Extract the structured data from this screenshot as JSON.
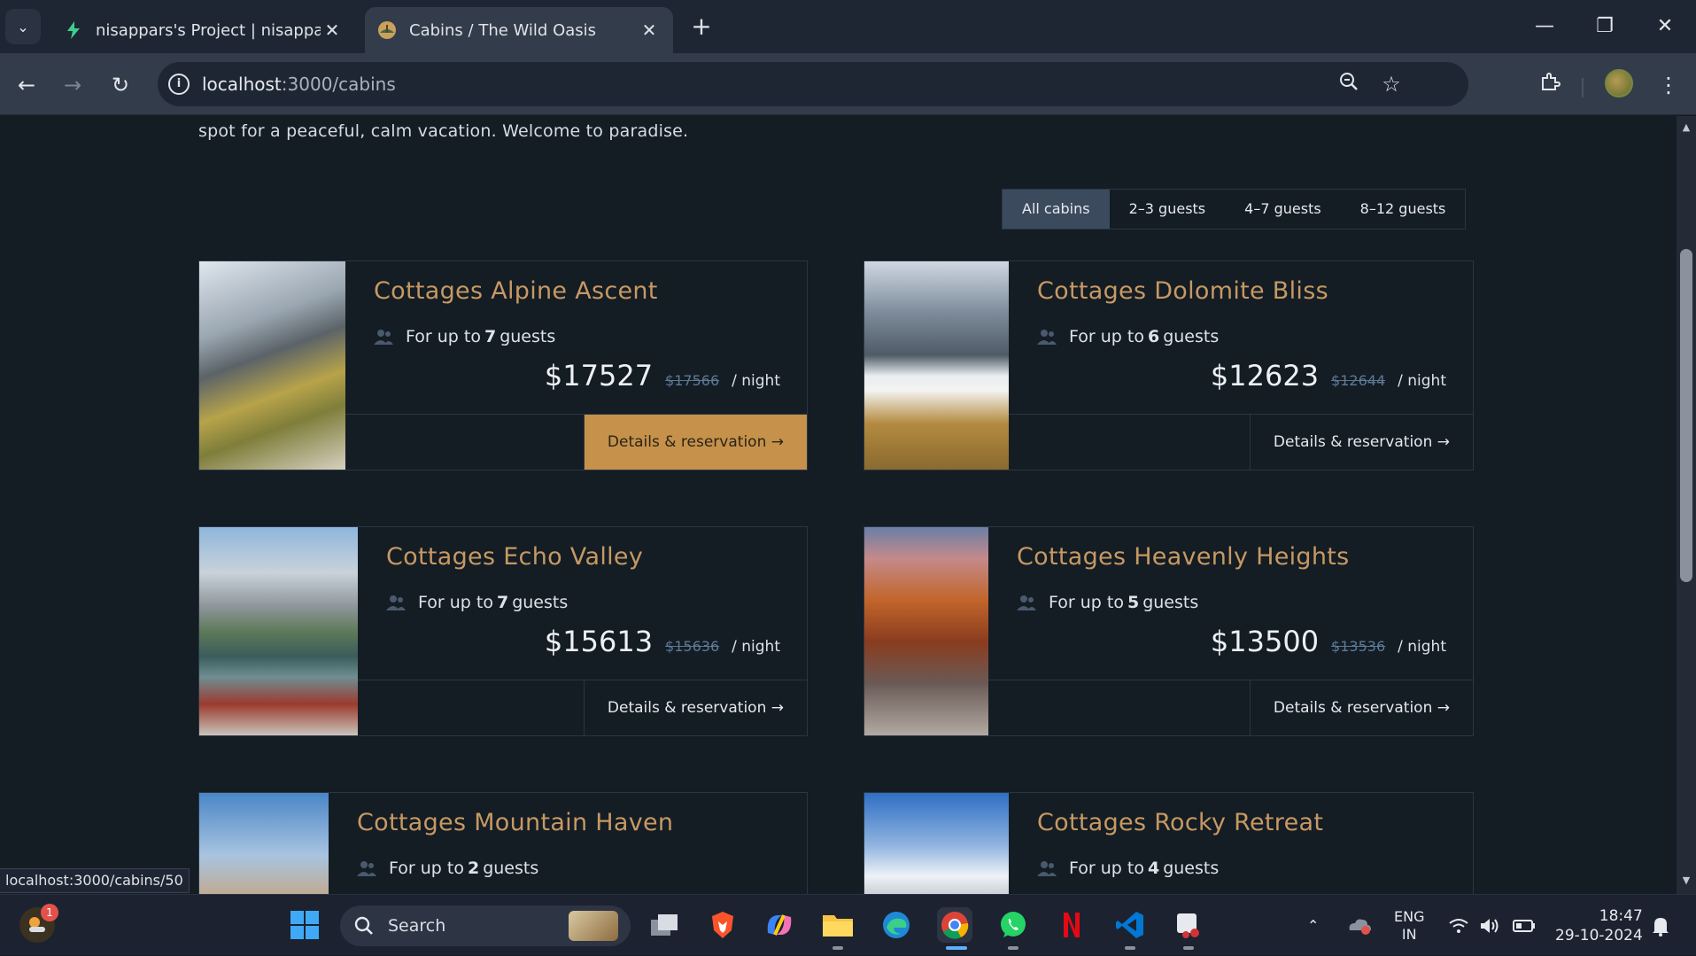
{
  "browser": {
    "tabs": [
      {
        "title": "nisappars's Project | nisappars's",
        "active": false
      },
      {
        "title": "Cabins / The Wild Oasis",
        "active": true
      }
    ],
    "url_host": "localhost",
    "url_path": ":3000/cabins",
    "status_url": "localhost:3000/cabins/50"
  },
  "page": {
    "intro_text": "spot for a peaceful, calm vacation. Welcome to paradise.",
    "filter": {
      "options": [
        "All cabins",
        "2–3 guests",
        "4–7 guests",
        "8–12 guests"
      ],
      "active": "All cabins"
    },
    "cabins": [
      {
        "name": "Cottages Alpine Ascent",
        "cap_prefix": "For up to",
        "guests": "7",
        "cap_suffix": "guests",
        "price": "$17527",
        "old_price": "$17566",
        "per": "/ night",
        "cta": "Details & reservation →"
      },
      {
        "name": "Cottages Dolomite Bliss",
        "cap_prefix": "For up to",
        "guests": "6",
        "cap_suffix": "guests",
        "price": "$12623",
        "old_price": "$12644",
        "per": "/ night",
        "cta": "Details & reservation →"
      },
      {
        "name": "Cottages Echo Valley",
        "cap_prefix": "For up to",
        "guests": "7",
        "cap_suffix": "guests",
        "price": "$15613",
        "old_price": "$15636",
        "per": "/ night",
        "cta": "Details & reservation →"
      },
      {
        "name": "Cottages Heavenly Heights",
        "cap_prefix": "For up to",
        "guests": "5",
        "cap_suffix": "guests",
        "price": "$13500",
        "old_price": "$13536",
        "per": "/ night",
        "cta": "Details & reservation →"
      },
      {
        "name": "Cottages Mountain Haven",
        "cap_prefix": "For up to",
        "guests": "2",
        "cap_suffix": "guests"
      },
      {
        "name": "Cottages Rocky Retreat",
        "cap_prefix": "For up to",
        "guests": "4",
        "cap_suffix": "guests"
      }
    ],
    "accent_color": "#c69963",
    "cta_hover_color": "#c6914a"
  },
  "taskbar": {
    "search_label": "Search",
    "notification_count": "1",
    "lang": "ENG",
    "region": "IN",
    "time": "18:47",
    "date": "29-10-2024"
  }
}
